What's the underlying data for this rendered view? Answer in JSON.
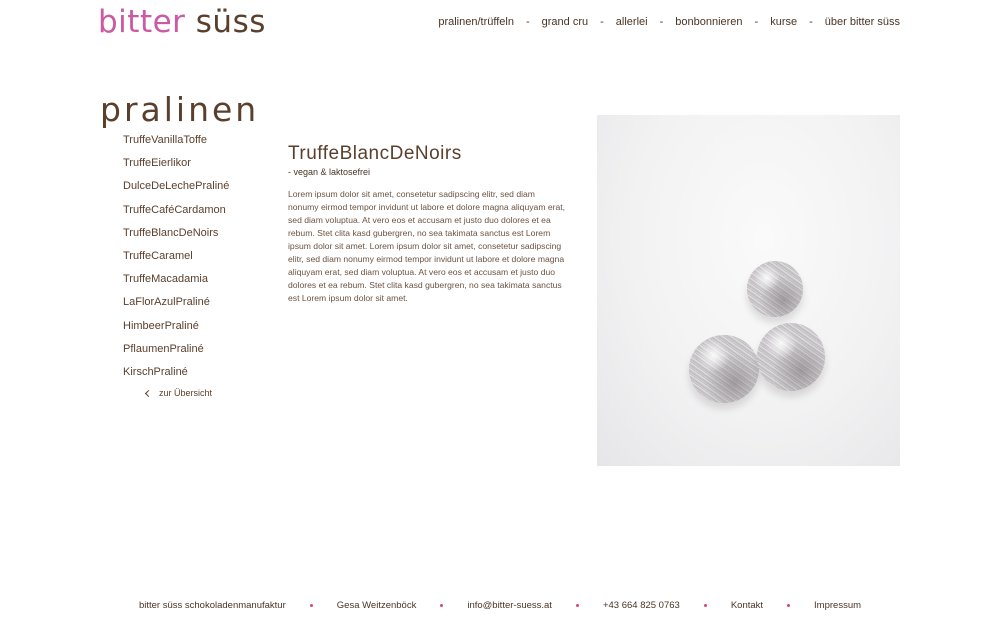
{
  "header": {
    "logo_part1": "bitter",
    "logo_part2": "süss",
    "nav": [
      {
        "label": "pralinen/trüffeln"
      },
      {
        "label": "grand cru"
      },
      {
        "label": "allerlei"
      },
      {
        "label": "bonbonnieren"
      },
      {
        "label": "kurse"
      },
      {
        "label": "über bitter süss"
      }
    ],
    "nav_separator": "-"
  },
  "section": {
    "title": "pralinen"
  },
  "sidebar": {
    "items": [
      {
        "label": "TruffeVanillaToffe"
      },
      {
        "label": "TruffeEierlikor"
      },
      {
        "label": "DulceDeLechePraliné"
      },
      {
        "label": "TruffeCaféCardamon"
      },
      {
        "label": "TruffeBlancDeNoirs"
      },
      {
        "label": "TruffeCaramel"
      },
      {
        "label": "TruffeMacadamia"
      },
      {
        "label": "LaFlorAzulPraliné"
      },
      {
        "label": "HimbeerPraliné"
      },
      {
        "label": "PflaumenPraliné"
      },
      {
        "label": "KirschPraliné"
      }
    ],
    "back_label": "zur Übersicht"
  },
  "product": {
    "title": "TruffeBlancDeNoirs",
    "subtitle": "- vegan & laktosefrei",
    "description": "Lorem ipsum dolor sit amet, consetetur sadipscing elitr, sed diam nonumy eirmod tempor invidunt ut labore et dolore magna aliquyam erat, sed diam voluptua. At vero eos et accusam et justo duo dolores et ea rebum. Stet clita kasd gubergren, no sea takimata sanctus est Lorem ipsum dolor sit amet. Lorem ipsum dolor sit amet, consetetur sadipscing elitr, sed diam nonumy eirmod tempor invidunt ut labore et dolore magna aliquyam erat, sed diam voluptua. At vero eos et accusam et justo duo dolores et ea rebum. Stet clita kasd gubergren, no sea takimata sanctus est Lorem ipsum dolor sit amet."
  },
  "footer": {
    "items": [
      {
        "label": "bitter süss schokoladenmanufaktur"
      },
      {
        "label": "Gesa Weitzenböck"
      },
      {
        "label": "info@bitter-suess.at"
      },
      {
        "label": "+43 664 825 0763"
      },
      {
        "label": "Kontakt"
      },
      {
        "label": "Impressum"
      }
    ]
  },
  "colors": {
    "logo_pink": "#cc5aa2",
    "brown": "#5a3f2c",
    "footer_dot": "#e0417a"
  }
}
